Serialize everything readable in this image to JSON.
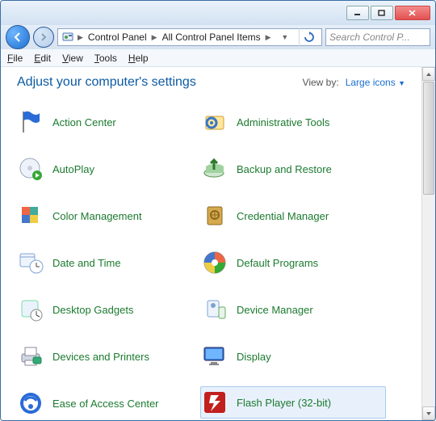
{
  "breadcrumb": {
    "icon": "control-panel",
    "parts": [
      "Control Panel",
      "All Control Panel Items"
    ]
  },
  "search": {
    "placeholder": "Search Control P..."
  },
  "menus": [
    "File",
    "Edit",
    "View",
    "Tools",
    "Help"
  ],
  "header": "Adjust your computer's settings",
  "viewby": {
    "label": "View by:",
    "value": "Large icons"
  },
  "items": [
    {
      "label": "Action Center",
      "icon": "flag"
    },
    {
      "label": "Administrative Tools",
      "icon": "gear-folder"
    },
    {
      "label": "AutoPlay",
      "icon": "cd-play"
    },
    {
      "label": "Backup and Restore",
      "icon": "backup"
    },
    {
      "label": "Color Management",
      "icon": "color"
    },
    {
      "label": "Credential Manager",
      "icon": "vault"
    },
    {
      "label": "Date and Time",
      "icon": "clock"
    },
    {
      "label": "Default Programs",
      "icon": "defaults"
    },
    {
      "label": "Desktop Gadgets",
      "icon": "gadgets"
    },
    {
      "label": "Device Manager",
      "icon": "device"
    },
    {
      "label": "Devices and Printers",
      "icon": "printer"
    },
    {
      "label": "Display",
      "icon": "display"
    },
    {
      "label": "Ease of Access Center",
      "icon": "ease"
    },
    {
      "label": "Flash Player (32-bit)",
      "icon": "flash",
      "selected": true
    }
  ]
}
